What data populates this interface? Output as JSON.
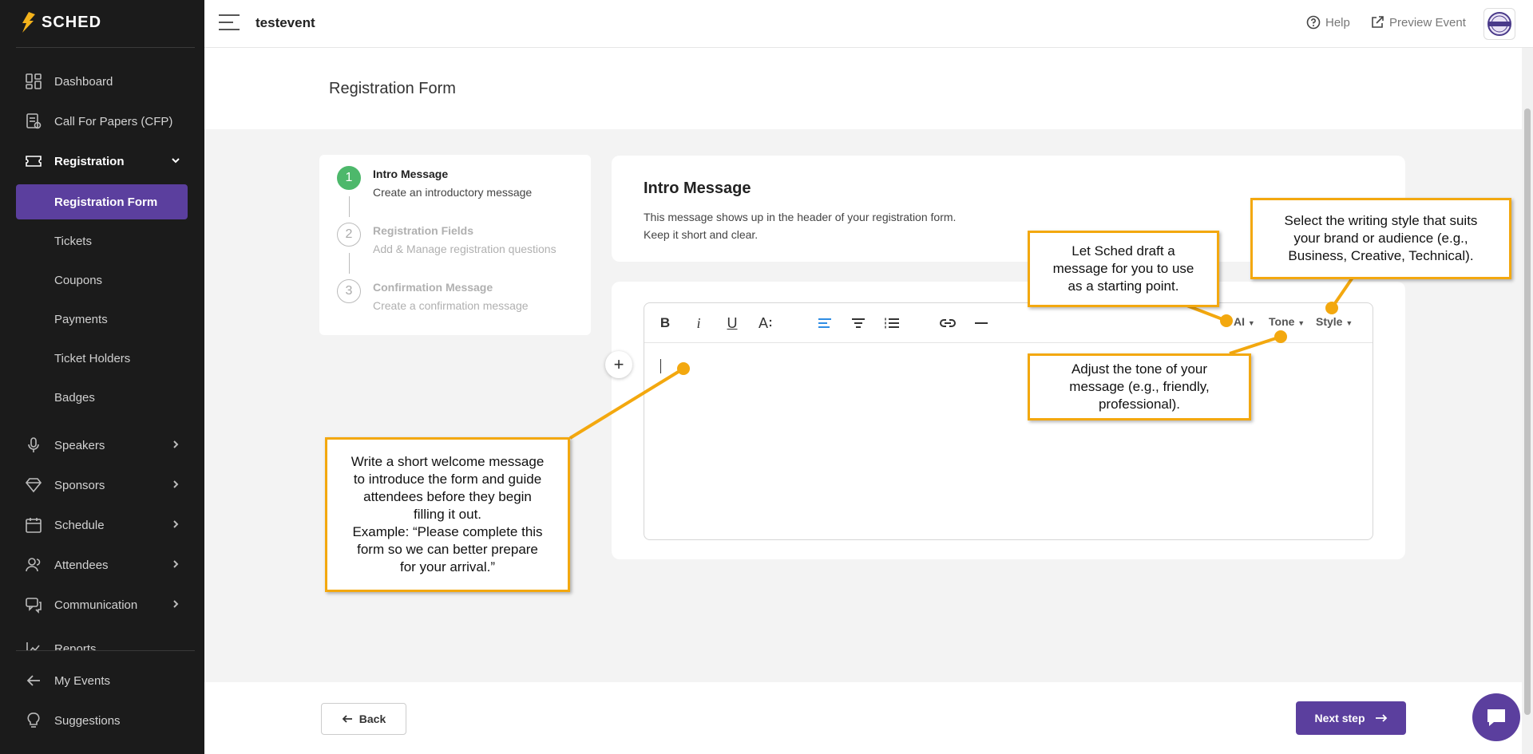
{
  "app": {
    "logo_text": "SCHED"
  },
  "sidebar": {
    "items": [
      {
        "label": "Dashboard",
        "icon": "dashboard-icon"
      },
      {
        "label": "Call For Papers (CFP)",
        "icon": "cfp-icon"
      },
      {
        "label": "Registration",
        "icon": "ticket-icon"
      },
      {
        "label": "Speakers",
        "icon": "microphone-icon"
      },
      {
        "label": "Sponsors",
        "icon": "diamond-icon"
      },
      {
        "label": "Schedule",
        "icon": "calendar-icon"
      },
      {
        "label": "Attendees",
        "icon": "users-icon"
      },
      {
        "label": "Communication",
        "icon": "chat-icon"
      },
      {
        "label": "Reports",
        "icon": "chart-icon"
      }
    ],
    "registration_sub": [
      "Registration Form",
      "Tickets",
      "Coupons",
      "Payments",
      "Ticket Holders",
      "Badges"
    ],
    "bottom": [
      {
        "label": "My Events",
        "icon": "arrow-left-icon"
      },
      {
        "label": "Suggestions",
        "icon": "lightbulb-icon"
      }
    ]
  },
  "header": {
    "event_name": "testevent",
    "help_label": "Help",
    "preview_label": "Preview Event",
    "avatar_text": "SAMPLE ONLY"
  },
  "page": {
    "title": "Registration Form"
  },
  "steps": [
    {
      "number": "1",
      "title": "Intro Message",
      "subtitle": "Create an introductory message"
    },
    {
      "number": "2",
      "title": "Registration Fields",
      "subtitle": "Add & Manage registration questions"
    },
    {
      "number": "3",
      "title": "Confirmation Message",
      "subtitle": "Create a confirmation message"
    }
  ],
  "intro": {
    "title": "Intro Message",
    "desc_line1": "This message shows up in the header of your registration form.",
    "desc_line2": "Keep it short and clear."
  },
  "editor": {
    "tools": [
      "B",
      "i",
      "U",
      "A"
    ],
    "dropdowns": [
      "AI",
      "Tone",
      "Style"
    ]
  },
  "callouts": {
    "ai": [
      "Let Sched draft a",
      "message for you to use",
      "as a starting point."
    ],
    "style": [
      "Select the writing style that suits",
      "your brand or audience (e.g.,",
      "Business, Creative, Technical)."
    ],
    "tone": [
      "Adjust the tone of your",
      "message (e.g., friendly,",
      "professional)."
    ],
    "welcome": [
      "Write a short welcome message",
      "to introduce the form and guide",
      "attendees before they begin",
      "filling it out.",
      "Example: “Please complete this",
      "form so we can better prepare",
      "for your arrival.”"
    ]
  },
  "footer": {
    "back_label": "Back",
    "next_label": "Next step"
  },
  "colors": {
    "accent": "#5b3f9e",
    "callout_border": "#f3a80f",
    "step_done": "#4db86b"
  }
}
